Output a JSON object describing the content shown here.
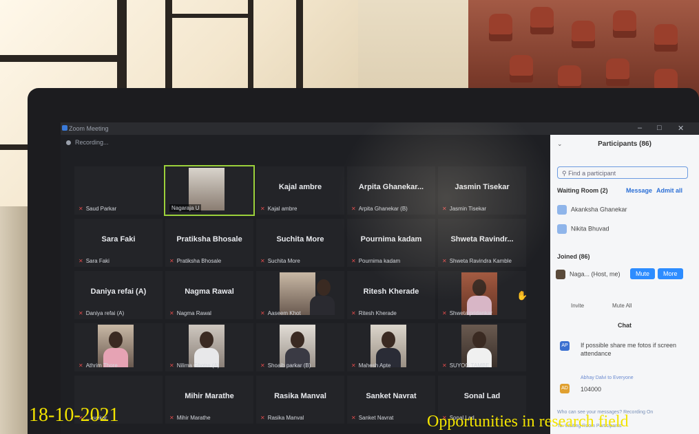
{
  "window": {
    "title": "Zoom Meeting",
    "recording": "Recording..."
  },
  "tiles": {
    "r1": [
      {
        "label": "Saud Parkar"
      },
      {
        "label": "Nagaraja U"
      },
      {
        "big": "Kajal ambre",
        "label": "Kajal ambre"
      },
      {
        "big": "Arpita Ghanekar...",
        "label": "Arpita Ghanekar (B)"
      },
      {
        "big": "Jasmin Tisekar",
        "label": "Jasmin Tisekar"
      }
    ],
    "r2": [
      {
        "big": "Sara Faki",
        "label": "Sara Faki"
      },
      {
        "big": "Pratiksha Bhosale",
        "label": "Pratiksha Bhosale"
      },
      {
        "big": "Suchita More",
        "label": "Suchita More"
      },
      {
        "big": "Pournima kadam",
        "label": "Pournima kadam"
      },
      {
        "big": "Shweta Ravindr...",
        "label": "Shweta Ravindra Kamble"
      }
    ],
    "r3": [
      {
        "big": "Daniya refai (A)",
        "label": "Daniya refai (A)"
      },
      {
        "big": "Nagma Rawal",
        "label": "Nagma Rawal"
      },
      {
        "label": "Aaseem Khot"
      },
      {
        "big": "Ritesh Kherade",
        "label": "Ritesh Kherade"
      },
      {
        "label": "Shweta pridankar"
      }
    ],
    "r4": [
      {
        "label": "Athrim Thore"
      },
      {
        "label": "Nilima Ghotre (A)"
      },
      {
        "label": "Shoaib parkar (B)"
      },
      {
        "label": "Mahesh Apte"
      },
      {
        "label": "SUYOG TAMBE"
      }
    ],
    "r5": [
      {
        "label": "...avekar"
      },
      {
        "big": "Mihir Marathe",
        "label": "Mihir Marathe"
      },
      {
        "big": "Rasika Manval",
        "label": "Rasika Manval"
      },
      {
        "big": "Sanket Navrat",
        "label": "Sanket Navrat"
      },
      {
        "big": "Sonal Lad",
        "label": "Sonal Lad"
      }
    ]
  },
  "panel": {
    "title": "Participants (86)",
    "search_placeholder": "Find a participant",
    "waiting_room": "Waiting Room (2)",
    "message": "Message",
    "admit_all": "Admit all",
    "waiting": [
      "Akanksha Ghanekar",
      "Nikita Bhuvad"
    ],
    "joined": "Joined (86)",
    "host": "Naga... (Host, me)",
    "mute": "Mute",
    "more": "More",
    "invite": "Invite",
    "mute_all": "Mute All",
    "chat_title": "Chat",
    "chat_msg1": "If possible share me fotos if screen attendance",
    "chat_meta": "Abhay Dalvi to Everyone",
    "chat_msg2": "104000",
    "footer1": "Who can see your messages? Recording On",
    "footer2": "To: Waiting Room Participants"
  },
  "overlay": {
    "date": "18-10-2021",
    "caption": "Opportunities in research field"
  }
}
